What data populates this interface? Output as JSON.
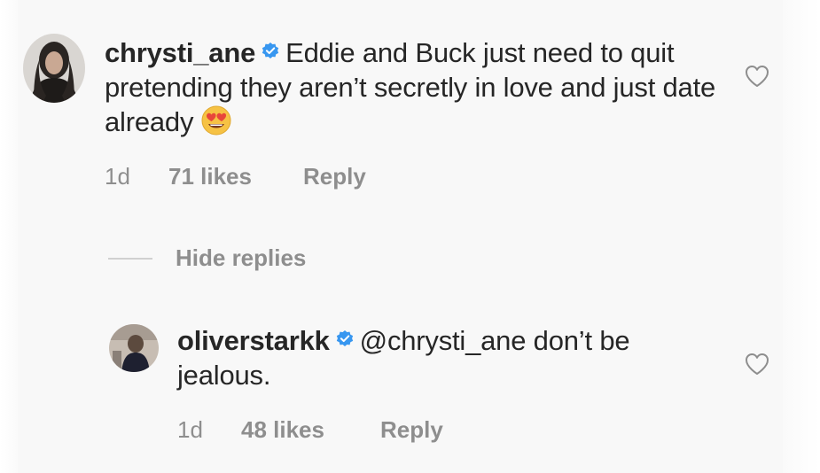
{
  "comments": [
    {
      "username": "chrysti_ane",
      "verified": true,
      "text": "Eddie and Buck just need to quit pretending they aren’t secretly in love and just date already",
      "emoji": "smiling-face-with-heart-eyes",
      "time": "1d",
      "likes": "71 likes",
      "reply_label": "Reply"
    },
    {
      "username": "oliverstarkk",
      "verified": true,
      "text": "@chrysti_ane don’t be jealous.",
      "time": "1d",
      "likes": "48 likes",
      "reply_label": "Reply"
    }
  ],
  "thread": {
    "hide_replies_label": "Hide replies"
  },
  "colors": {
    "verified_blue": "#3897f0",
    "meta_gray": "#8e8e8e",
    "text": "#262626"
  },
  "icons": {
    "verified": "verified-badge-icon",
    "like": "heart-outline-icon",
    "emoji": "heart-eyes-emoji-icon"
  }
}
